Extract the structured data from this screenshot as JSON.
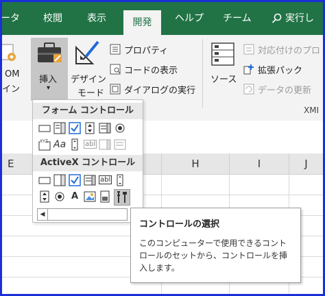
{
  "tabs": {
    "items": [
      {
        "label": "ータ"
      },
      {
        "label": "校閲"
      },
      {
        "label": "表示"
      },
      {
        "label": "開発"
      },
      {
        "label": "ヘルプ"
      },
      {
        "label": "チーム"
      }
    ],
    "active": "開発",
    "tell_me": "実行し"
  },
  "ribbon": {
    "addins_partial_1": "OM",
    "addins_partial_2": "イン",
    "insert_line1": "挿入",
    "insert_arrow": "▾",
    "design_line1": "デザイン",
    "design_line2": "モード",
    "properties": "プロパティ",
    "view_code": "コードの表示",
    "run_dialog": "ダイアログの実行",
    "source": "ソース",
    "map_properties": "対応付けのプロ",
    "expansion_packs": "拡張パック",
    "refresh_data": "データの更新",
    "xml_group_label": "XMI"
  },
  "grid": {
    "col_e": "E",
    "col_h": "H",
    "col_i": "I",
    "col_j": "J"
  },
  "dropdown": {
    "form_controls_header": "フォーム コントロール",
    "activex_header": "ActiveX コントロール",
    "aa_label": "Aa",
    "abl_label": "abl",
    "xyz_label": "XYZ",
    "a_label": "A",
    "scroll_arrow": "◀"
  },
  "tooltip": {
    "title": "コントロールの選択",
    "line1": "このコンピューターで使用できるコント",
    "line2": "ロールのセットから、コントロールを挿",
    "line3": "入します。"
  },
  "colors": {
    "excel_green": "#217346",
    "frame_blue": "#1a2fd6",
    "check_blue": "#1e6bd6"
  }
}
